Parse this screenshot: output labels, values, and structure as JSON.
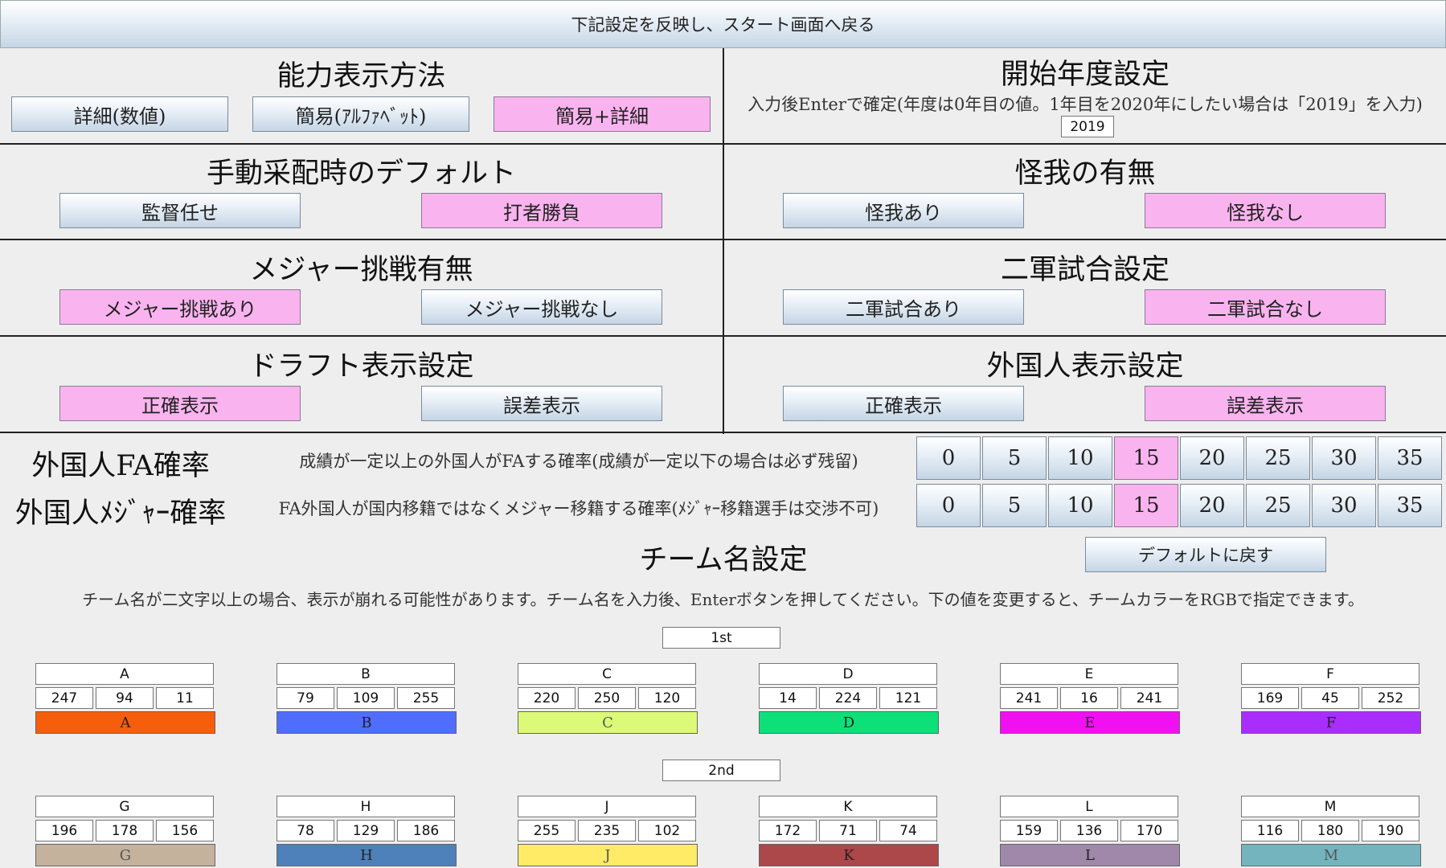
{
  "top_button": "下記設定を反映し、スタート画面へ戻る",
  "ability": {
    "title": "能力表示方法",
    "options": [
      "詳細(数値)",
      "簡易(ｱﾙﾌｧﾍﾞｯﾄ)",
      "簡易+詳細"
    ],
    "selected": 2
  },
  "start_year": {
    "title": "開始年度設定",
    "note": "入力後Enterで確定(年度は0年目の値。1年目を2020年にしたい場合は「2019」を入力)",
    "value": "2019"
  },
  "manual": {
    "title": "手動采配時のデフォルト",
    "options": [
      "監督任せ",
      "打者勝負"
    ],
    "selected": 1
  },
  "injury": {
    "title": "怪我の有無",
    "options": [
      "怪我あり",
      "怪我なし"
    ],
    "selected": 1
  },
  "major": {
    "title": "メジャー挑戦有無",
    "options": [
      "メジャー挑戦あり",
      "メジャー挑戦なし"
    ],
    "selected": 0
  },
  "farm": {
    "title": "二軍試合設定",
    "options": [
      "二軍試合あり",
      "二軍試合なし"
    ],
    "selected": 1
  },
  "draft": {
    "title": "ドラフト表示設定",
    "options": [
      "正確表示",
      "誤差表示"
    ],
    "selected": 0
  },
  "foreign_display": {
    "title": "外国人表示設定",
    "options": [
      "正確表示",
      "誤差表示"
    ],
    "selected": 1
  },
  "fa_rate": {
    "title": "外国人FA確率",
    "note": "成績が一定以上の外国人がFAする確率(成績が一定以下の場合は必ず残留)",
    "options": [
      "0",
      "5",
      "10",
      "15",
      "20",
      "25",
      "30",
      "35"
    ],
    "selected": 3
  },
  "major_rate": {
    "title": "外国人ﾒｼﾞｬｰ確率",
    "note": "FA外国人が国内移籍ではなくメジャー移籍する確率(ﾒｼﾞｬｰ移籍選手は交渉不可)",
    "options": [
      "0",
      "5",
      "10",
      "15",
      "20",
      "25",
      "30",
      "35"
    ],
    "selected": 3
  },
  "team": {
    "title": "チーム名設定",
    "reset_button": "デフォルトに戻す",
    "note": "チーム名が二文字以上の場合、表示が崩れる可能性があります。チーム名を入力後、Enterボタンを押してください。下の値を変更すると、チームカラーをRGBで指定できます。",
    "leagues": [
      {
        "name": "1st",
        "teams": [
          {
            "name": "A",
            "r": "247",
            "g": "94",
            "b": "11",
            "color": "#f75e0b"
          },
          {
            "name": "B",
            "r": "79",
            "g": "109",
            "b": "255",
            "color": "#4f6dff"
          },
          {
            "name": "C",
            "r": "220",
            "g": "250",
            "b": "120",
            "color": "#dcfa78"
          },
          {
            "name": "D",
            "r": "14",
            "g": "224",
            "b": "121",
            "color": "#0ee079"
          },
          {
            "name": "E",
            "r": "241",
            "g": "16",
            "b": "241",
            "color": "#f110f1"
          },
          {
            "name": "F",
            "r": "169",
            "g": "45",
            "b": "252",
            "color": "#a92dfc"
          }
        ]
      },
      {
        "name": "2nd",
        "teams": [
          {
            "name": "G",
            "r": "196",
            "g": "178",
            "b": "156",
            "color": "#c4b29c"
          },
          {
            "name": "H",
            "r": "78",
            "g": "129",
            "b": "186",
            "color": "#4e81ba"
          },
          {
            "name": "J",
            "r": "255",
            "g": "235",
            "b": "102",
            "color": "#ffeb66"
          },
          {
            "name": "K",
            "r": "172",
            "g": "71",
            "b": "74",
            "color": "#ac474a"
          },
          {
            "name": "L",
            "r": "159",
            "g": "136",
            "b": "170",
            "color": "#9f88aa"
          },
          {
            "name": "M",
            "r": "116",
            "g": "180",
            "b": "190",
            "color": "#74b4be"
          }
        ]
      }
    ]
  }
}
